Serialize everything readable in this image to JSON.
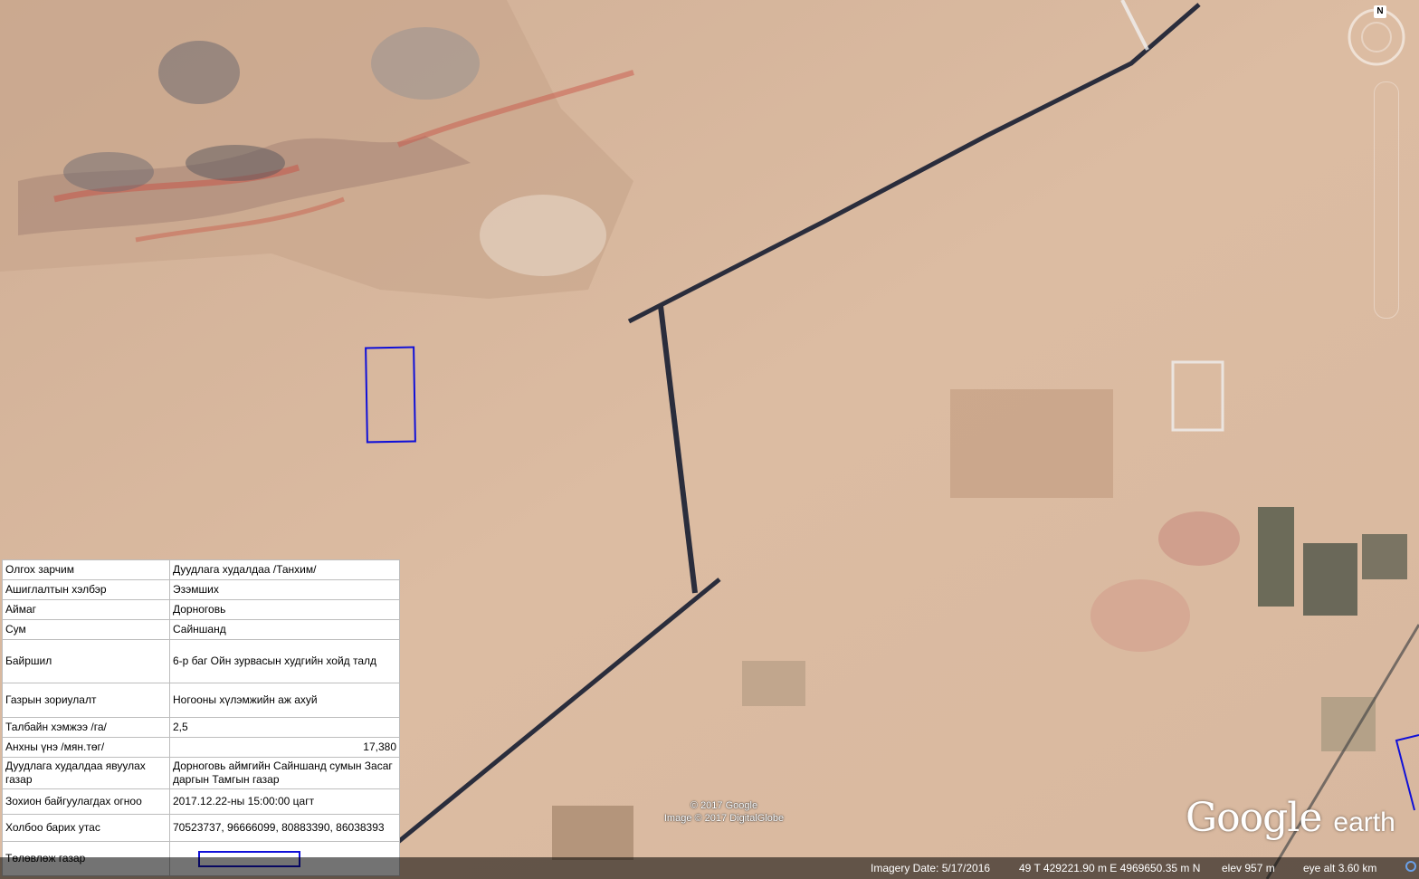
{
  "info_table": {
    "rows": [
      {
        "label": "Олгох зарчим",
        "value": "Дуудлага худалдаа /Танхим/"
      },
      {
        "label": "Ашиглалтын хэлбэр",
        "value": "Эзэмших"
      },
      {
        "label": "Аймаг",
        "value": "Дорноговь"
      },
      {
        "label": "Сум",
        "value": "Сайншанд"
      },
      {
        "label": "Байршил",
        "value": "6-р баг Ойн зурвасын худгийн хойд талд"
      },
      {
        "label": "Газрын зориулалт",
        "value": "Ногооны хүлэмжийн аж ахуй"
      },
      {
        "label": "Талбайн хэмжээ /га/",
        "value": "2,5"
      },
      {
        "label": "Анхны үнэ /мян.төг/",
        "value": "17,380"
      },
      {
        "label": "Дуудлага худалдаа явуулах газар",
        "value": "Дорноговь аймгийн Сайншанд сумын Засаг даргын Тамгын газар"
      },
      {
        "label": "Зохион байгуулагдах огноо",
        "value": "2017.12.22-ны 15:00:00 цагт"
      },
      {
        "label": "Холбоо барих утас",
        "value": "70523737, 96666099, 80883390, 86038393"
      },
      {
        "label": "Төлөвлөж газар",
        "value": ""
      }
    ],
    "legend_color": "#1010d8"
  },
  "copyright": {
    "line1": "© 2017 Google",
    "line2": "Image © 2017 DigitalGlobe"
  },
  "brand": {
    "google": "Google",
    "earth": "earth"
  },
  "compass": {
    "north_label": "N"
  },
  "status_bar": {
    "imagery_date": "Imagery Date: 5/17/2016",
    "coords": "49 T 429221.90 m E 4969650.35 m N",
    "elev": "elev   957 m",
    "eye_alt": "eye alt   3.60 km"
  },
  "icons": [
    "compass-icon",
    "navigation-slider-icon",
    "streaming-status-icon"
  ],
  "colors": {
    "plot_outline": "#1010d8",
    "road": "#2a2d3c",
    "terrain": "#d9b89e"
  }
}
